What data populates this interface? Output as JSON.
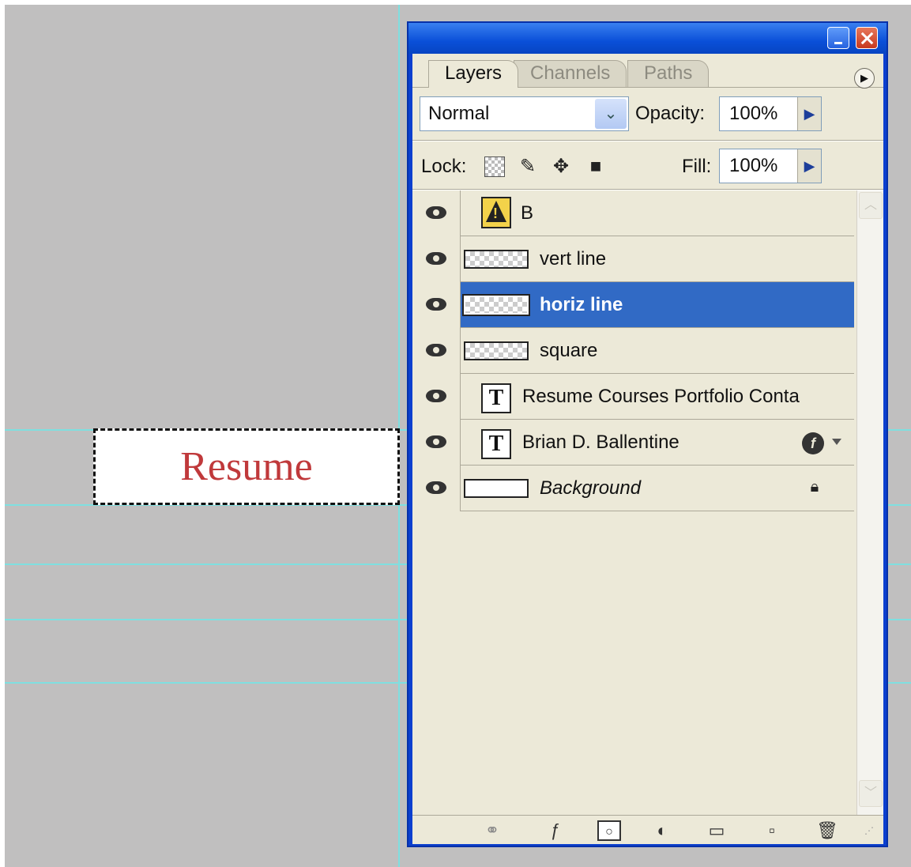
{
  "canvas": {
    "resume_text": "Resume"
  },
  "palette": {
    "tabs": [
      {
        "label": "Layers",
        "active": true
      },
      {
        "label": "Channels",
        "active": false
      },
      {
        "label": "Paths",
        "active": false
      }
    ],
    "blend_mode": "Normal",
    "opacity_label": "Opacity:",
    "opacity_value": "100%",
    "lock_label": "Lock:",
    "fill_label": "Fill:",
    "fill_value": "100%",
    "layers": [
      {
        "name": "B",
        "thumbnail": "warning-icon",
        "visible": true,
        "selected": false
      },
      {
        "name": "vert line",
        "thumbnail": "transparent",
        "visible": true,
        "selected": false
      },
      {
        "name": "horiz line",
        "thumbnail": "transparent",
        "visible": true,
        "selected": true
      },
      {
        "name": "square",
        "thumbnail": "transparent",
        "visible": true,
        "selected": false
      },
      {
        "name": "Resume Courses Portfolio Conta",
        "thumbnail": "text-layer",
        "visible": true,
        "selected": false
      },
      {
        "name": "Brian D. Ballentine",
        "thumbnail": "text-layer",
        "visible": true,
        "selected": false,
        "has_effects": true
      },
      {
        "name": "Background",
        "thumbnail": "white",
        "visible": true,
        "selected": false,
        "locked": true
      }
    ],
    "footer_icons": [
      "link-icon",
      "layer-style-icon",
      "layer-mask-icon",
      "adjustment-layer-icon",
      "new-group-icon",
      "new-layer-icon",
      "trash-icon"
    ],
    "colors": {
      "selection": "#316ac5",
      "panel": "#ece9d8",
      "titlebar": "#0a4fd8",
      "guide": "#7fdfe0",
      "resume_text": "#c0393b"
    }
  }
}
